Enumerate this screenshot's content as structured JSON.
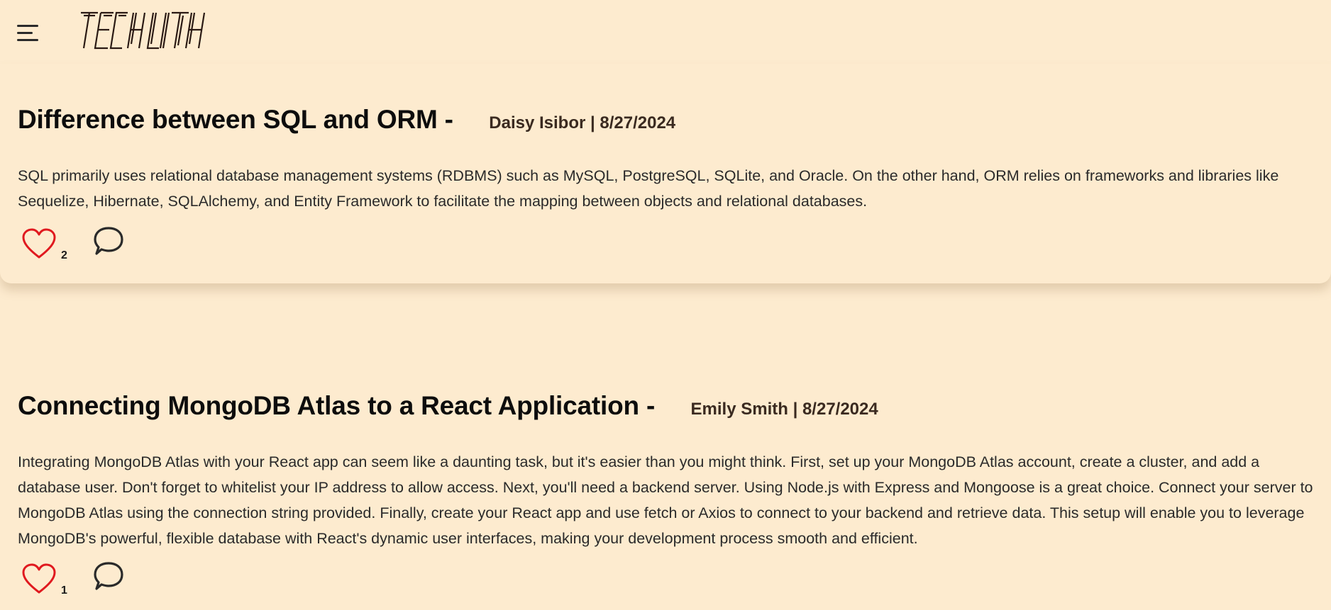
{
  "header": {
    "menu_icon": "hamburger-menu-icon",
    "logo_text": "TECHLITH"
  },
  "posts": [
    {
      "title": "Difference between SQL and ORM -",
      "meta": "Daisy Isibor | 8/27/2024",
      "body": "SQL primarily uses relational database management systems (RDBMS) such as MySQL, PostgreSQL, SQLite, and Oracle. On the other hand, ORM relies on frameworks and libraries like Sequelize, Hibernate, SQLAlchemy, and Entity Framework to facilitate the mapping between objects and relational databases.",
      "likes": "2",
      "like_icon": "heart-icon",
      "comment_icon": "comment-bubble-icon"
    },
    {
      "title": "Connecting MongoDB Atlas to a React Application -",
      "meta": "Emily Smith | 8/27/2024",
      "body": "Integrating MongoDB Atlas with your React app can seem like a daunting task, but it's easier than you might think. First, set up your MongoDB Atlas account, create a cluster, and add a database user. Don't forget to whitelist your IP address to allow access. Next, you'll need a backend server. Using Node.js with Express and Mongoose is a great choice. Connect your server to MongoDB Atlas using the connection string provided. Finally, create your React app and use fetch or Axios to connect to your backend and retrieve data. This setup will enable you to leverage MongoDB's powerful, flexible database with React's dynamic user interfaces, making your development process smooth and efficient.",
      "likes": "1",
      "like_icon": "heart-icon",
      "comment_icon": "comment-bubble-icon"
    }
  ],
  "colors": {
    "background": "#fdebcf",
    "heart": "#e0191f",
    "text": "#1a1a1a",
    "meta": "#3a2a20"
  }
}
